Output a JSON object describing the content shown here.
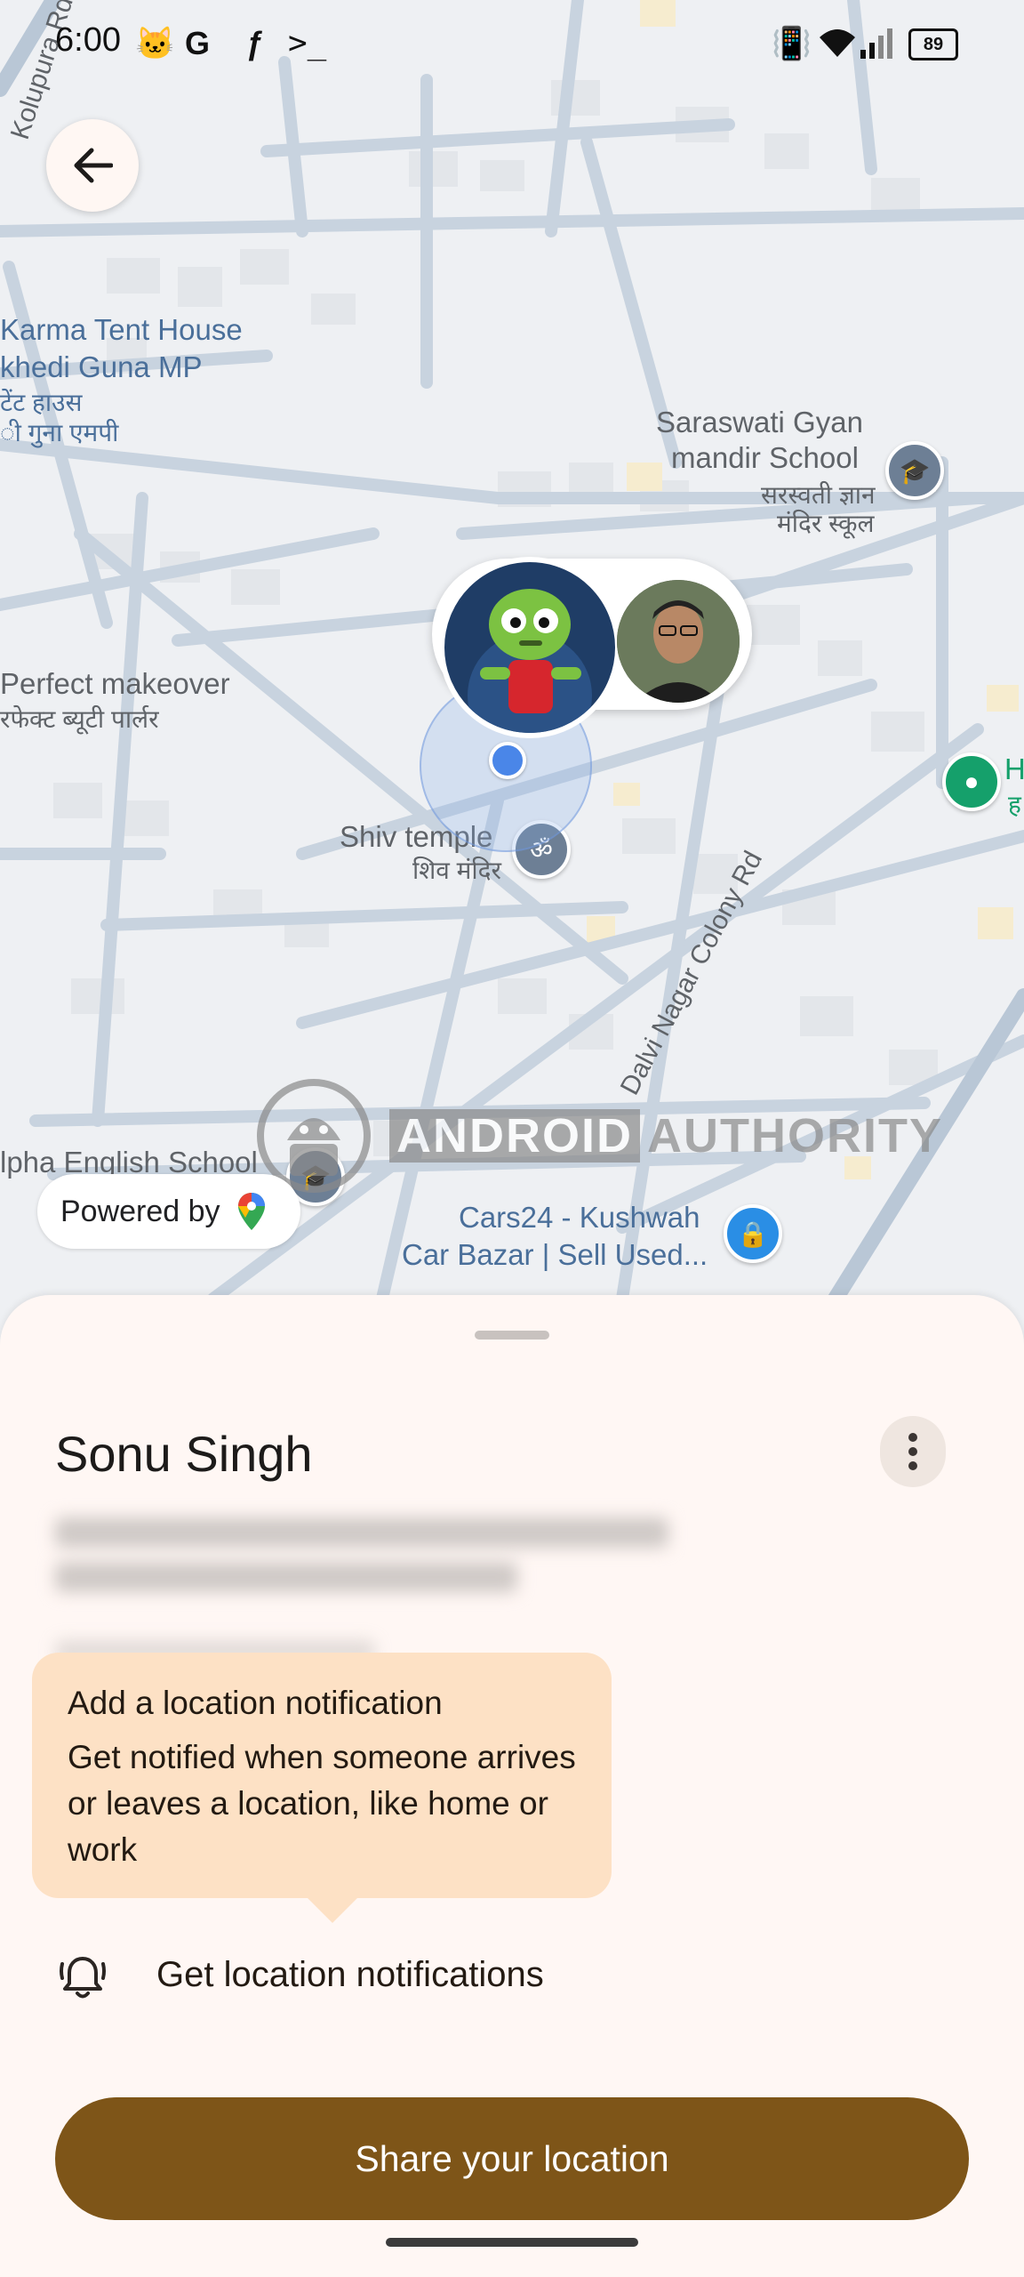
{
  "status_bar": {
    "time": "6:00",
    "app_icons": [
      "cat-icon",
      "google-icon",
      "feather-icon",
      "terminal-icon"
    ],
    "battery": "89"
  },
  "map": {
    "labels": {
      "kolupura": "Kolupura Rd",
      "karma1": "Karma Tent House",
      "karma2": "khedi Guna MP",
      "karma3": "टेंट हाउस",
      "karma4": "ी गुना एमपी",
      "saraswati1": "Saraswati Gyan",
      "saraswati2": "mandir School",
      "saraswati3": "सरस्वती ज्ञान",
      "saraswati4": "मंदिर स्कूल",
      "perfect1": "Perfect makeover",
      "perfect2": "रफेक्ट ब्यूटी पार्लर",
      "shiv1": "Shiv temple",
      "shiv2": "शिव मंदिर",
      "dalvi": "Dalvi Nagar Colony Rd",
      "alpha": "lpha English School",
      "cars1": "Cars24 - Kushwah",
      "cars2": "Car Bazar | Sell Used...",
      "h_edge": "H",
      "h_edge_dev": "ह"
    },
    "powered_by": "Powered by",
    "watermark": {
      "android": "ANDROID",
      "authority": "AUTHORITY"
    }
  },
  "sheet": {
    "contact_name": "Sonu Singh",
    "tooltip": {
      "title": "Add a location notification",
      "body": "Get notified when someone arrives or leaves a location, like home or work"
    },
    "notifications_label": "Get location notifications",
    "share_button": "Share your location"
  },
  "colors": {
    "accent": "#7e5518",
    "tooltip_bg": "#fde1c5",
    "sheet_bg": "#fff7f4",
    "location_dot": "#4a86e8"
  }
}
